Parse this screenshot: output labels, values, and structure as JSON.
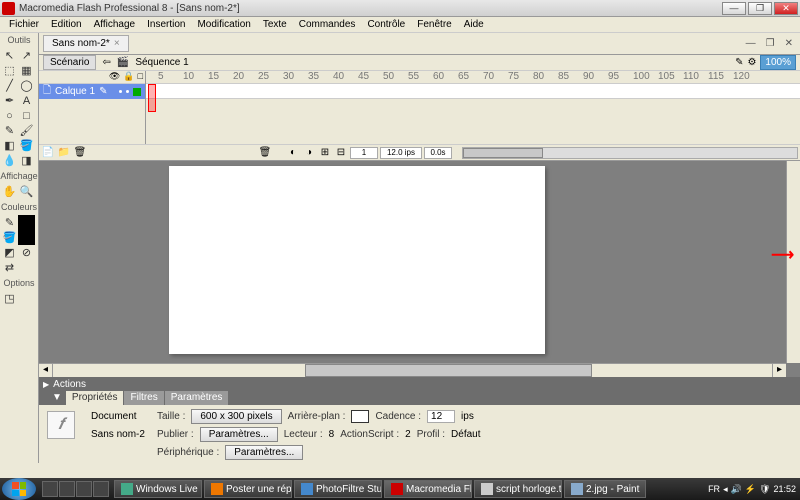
{
  "window": {
    "title": "Macromedia Flash Professional 8 - [Sans nom-2*]"
  },
  "menu": [
    "Fichier",
    "Edition",
    "Affichage",
    "Insertion",
    "Modification",
    "Texte",
    "Commandes",
    "Contrôle",
    "Fenêtre",
    "Aide"
  ],
  "toolbox": {
    "title_tools": "Outils",
    "title_view": "Affichage",
    "title_colors": "Couleurs",
    "title_options": "Options"
  },
  "doc_tab": {
    "name": "Sans nom-2*"
  },
  "scene": {
    "scenario_btn": "Scénario",
    "label": "Séquence 1",
    "zoom": "100%"
  },
  "layer": {
    "name": "Calque 1"
  },
  "ruler_marks": [
    "5",
    "10",
    "15",
    "20",
    "25",
    "30",
    "35",
    "40",
    "45",
    "50",
    "55",
    "60",
    "65",
    "70",
    "75",
    "80",
    "85",
    "90",
    "95",
    "100",
    "105",
    "110",
    "115",
    "120"
  ],
  "timeline_status": {
    "frame": "1",
    "fps": "12.0 ips",
    "time": "0.0s"
  },
  "actions": {
    "title": "Actions"
  },
  "props_tabs": [
    "Propriétés",
    "Filtres",
    "Paramètres"
  ],
  "props": {
    "doc_label": "Document",
    "doc_name": "Sans nom-2",
    "size_label": "Taille :",
    "size_value": "600 x 300 pixels",
    "bg_label": "Arrière-plan :",
    "cadence_label": "Cadence :",
    "cadence_value": "12",
    "cadence_unit": "ips",
    "publish_label": "Publier :",
    "settings_btn": "Paramètres...",
    "player_label": "Lecteur :",
    "player_value": "8",
    "as_label": "ActionScript :",
    "as_value": "2",
    "profile_label": "Profil :",
    "profile_value": "Défaut",
    "device_label": "Périphérique :"
  },
  "taskbar": {
    "items": [
      "Windows Live M...",
      "Poster une répo...",
      "PhotoFiltre Studi...",
      "Macromedia Fla...",
      "script horloge.txt...",
      "2.jpg - Paint"
    ],
    "lang": "FR",
    "time": "21:52"
  }
}
